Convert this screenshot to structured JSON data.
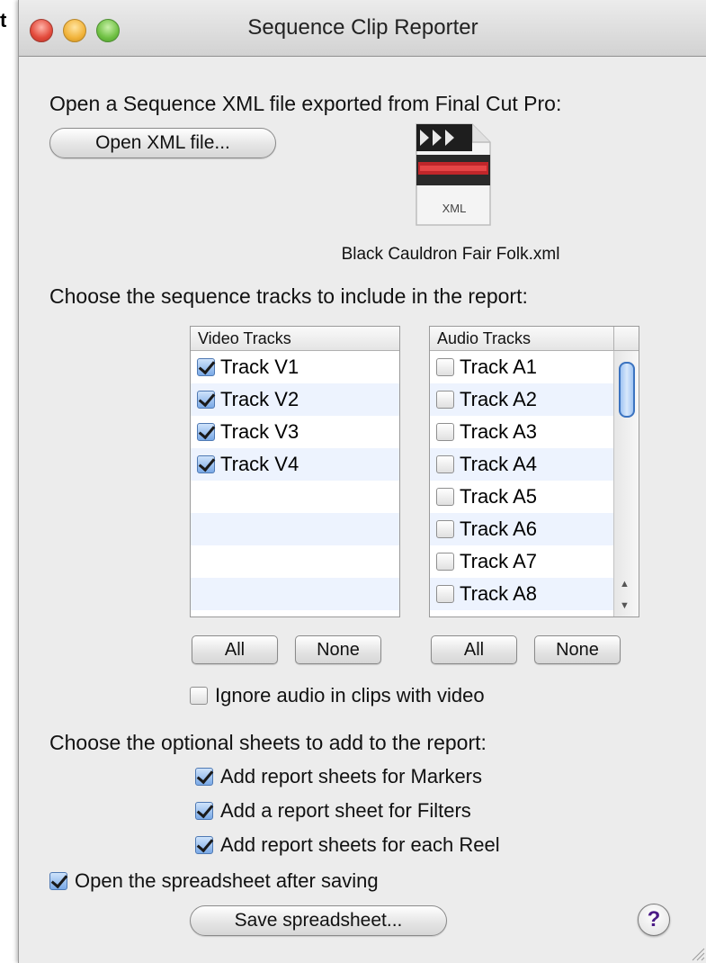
{
  "edge_fragment": "t",
  "window": {
    "title": "Sequence Clip Reporter"
  },
  "open_section": {
    "prompt": "Open a Sequence XML file exported from Final Cut Pro:",
    "open_button": "Open XML file...",
    "file_icon_label": "XML",
    "file_name": "Black Cauldron Fair Folk.xml"
  },
  "tracks_section": {
    "prompt": "Choose the sequence tracks to include in the report:",
    "video": {
      "header": "Video Tracks",
      "items": [
        {
          "label": "Track V1",
          "checked": true
        },
        {
          "label": "Track V2",
          "checked": true
        },
        {
          "label": "Track V3",
          "checked": true
        },
        {
          "label": "Track V4",
          "checked": true
        }
      ],
      "all_button": "All",
      "none_button": "None"
    },
    "audio": {
      "header": "Audio Tracks",
      "items": [
        {
          "label": "Track A1",
          "checked": false
        },
        {
          "label": "Track A2",
          "checked": false
        },
        {
          "label": "Track A3",
          "checked": false
        },
        {
          "label": "Track A4",
          "checked": false
        },
        {
          "label": "Track A5",
          "checked": false
        },
        {
          "label": "Track A6",
          "checked": false
        },
        {
          "label": "Track A7",
          "checked": false
        },
        {
          "label": "Track A8",
          "checked": false
        }
      ],
      "all_button": "All",
      "none_button": "None"
    },
    "ignore_audio": {
      "label": "Ignore audio in clips with video",
      "checked": false
    }
  },
  "sheets_section": {
    "prompt": "Choose the optional sheets to add to the report:",
    "options": [
      {
        "label": "Add report sheets for Markers",
        "checked": true
      },
      {
        "label": "Add a report sheet for Filters",
        "checked": true
      },
      {
        "label": "Add report sheets for each Reel",
        "checked": true
      }
    ]
  },
  "open_after": {
    "label": "Open the spreadsheet after saving",
    "checked": true
  },
  "save_button": "Save spreadsheet...",
  "help_button": "?",
  "colors": {
    "checkbox_checked": "#7aa9e6",
    "alt_row": "#edf3fe",
    "window_bg": "#ececec"
  }
}
